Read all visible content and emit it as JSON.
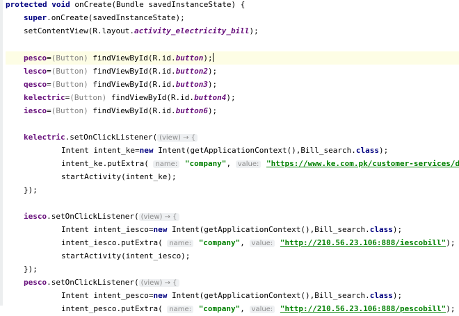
{
  "code": {
    "l1": {
      "kw1": "protected",
      "kw2": "void",
      "rest": " onCreate(Bundle savedInstanceState) {"
    },
    "l2": {
      "kw": "super",
      "rest": ".onCreate(savedInstanceState);"
    },
    "l3": {
      "a": "setContentView(R.layout.",
      "it": "activity_electricity_bill",
      "b": ");"
    },
    "l5": {
      "fld": "pesco",
      "a": "=",
      "cast": "(Button)",
      "b": " findViewById(R.id.",
      "it": "button",
      "c": ");"
    },
    "l6": {
      "fld": "lesco",
      "a": "=",
      "cast": "(Button)",
      "b": " findViewById(R.id.",
      "it": "button2",
      "c": ");"
    },
    "l7": {
      "fld": "qesco",
      "a": "=",
      "cast": "(Button)",
      "b": " findViewById(R.id.",
      "it": "button3",
      "c": ");"
    },
    "l8": {
      "fld": "kelectric",
      "a": "=",
      "cast": "(Button)",
      "b": " findViewById(R.id.",
      "it": "button4",
      "c": ");"
    },
    "l9": {
      "fld": "iesco",
      "a": "=",
      "cast": "(Button)",
      "b": " findViewById(R.id.",
      "it": "button6",
      "c": ");"
    },
    "l11": {
      "fld": "kelectric",
      "a": ".setOnClickListener(",
      "lambda": "(view) → {"
    },
    "l12": {
      "a": "Intent intent_ke=",
      "kw": "new",
      "b": " Intent(getApplicationContext(),Bill_search.",
      "kw2": "class",
      "c": ");"
    },
    "l13": {
      "a": "intent_ke.putExtra(",
      "h1": "name:",
      "s1": "\"company\"",
      "sep": ", ",
      "h2": "value:",
      "s2": "\"https://www.ke.com.pk/customer-services/dupl"
    },
    "l14": {
      "a": "startActivity(intent_ke);"
    },
    "l15": {
      "a": "});"
    },
    "l17": {
      "fld": "iesco",
      "a": ".setOnClickListener(",
      "lambda": "(view) → {"
    },
    "l18": {
      "a": "Intent intent_iesco=",
      "kw": "new",
      "b": " Intent(getApplicationContext(),Bill_search.",
      "kw2": "class",
      "c": ");"
    },
    "l19": {
      "a": "intent_iesco.putExtra(",
      "h1": "name:",
      "s1": "\"company\"",
      "sep": ", ",
      "h2": "value:",
      "s2": "\"http://210.56.23.106:888/iescobill\"",
      "c": ");"
    },
    "l20": {
      "a": "startActivity(intent_iesco);"
    },
    "l21": {
      "a": "});"
    },
    "l22": {
      "fld": "pesco",
      "a": ".setOnClickListener(",
      "lambda": "(view) → {"
    },
    "l23": {
      "a": "Intent intent_pesco=",
      "kw": "new",
      "b": " Intent(getApplicationContext(),Bill_search.",
      "kw2": "class",
      "c": ");"
    },
    "l24": {
      "a": "intent_pesco.putExtra(",
      "h1": "name:",
      "s1": "\"company\"",
      "sep": ", ",
      "h2": "value:",
      "s2": "\"http://210.56.23.106:888/pescobill\"",
      "c": ");"
    }
  },
  "colors": {
    "keyword": "#000080",
    "field": "#660e7a",
    "string": "#008000",
    "hint_background": "#eef0f2",
    "current_line": "#fdfde5"
  }
}
